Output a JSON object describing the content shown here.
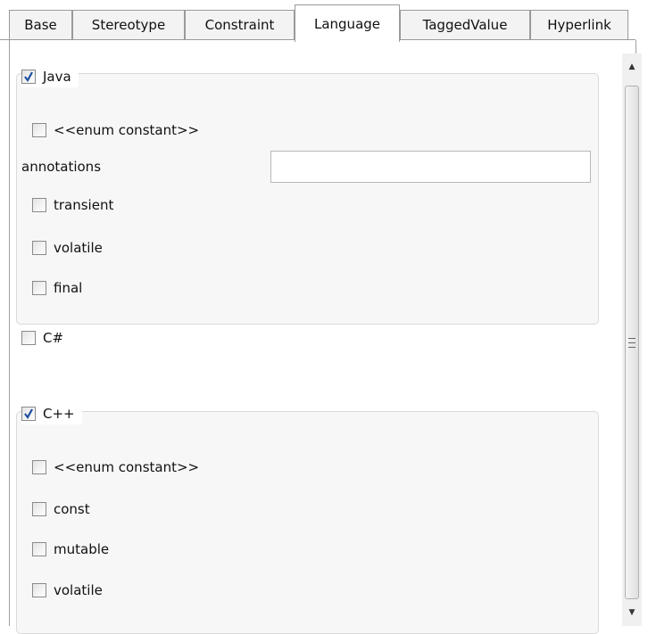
{
  "tabs": [
    {
      "label": "Base",
      "active": false
    },
    {
      "label": "Stereotype",
      "active": false
    },
    {
      "label": "Constraint",
      "active": false
    },
    {
      "label": "Language",
      "active": true
    },
    {
      "label": "TaggedValue",
      "active": false
    },
    {
      "label": "Hyperlink",
      "active": false
    }
  ],
  "java": {
    "label": "Java",
    "checked": true,
    "enum_constant": {
      "label": "<<enum constant>>",
      "checked": false
    },
    "annotations": {
      "label": "annotations",
      "value": ""
    },
    "transient": {
      "label": "transient",
      "checked": false
    },
    "volatile": {
      "label": "volatile",
      "checked": false
    },
    "final": {
      "label": "final",
      "checked": false
    }
  },
  "csharp": {
    "label": "C#",
    "checked": false
  },
  "cpp": {
    "label": "C++",
    "checked": true,
    "enum_constant": {
      "label": "<<enum constant>>",
      "checked": false
    },
    "const": {
      "label": "const",
      "checked": false
    },
    "mutable": {
      "label": "mutable",
      "checked": false
    },
    "volatile": {
      "label": "volatile",
      "checked": false
    }
  },
  "colors": {
    "check": "#1f4f9e",
    "panel_bg": "#f7f7f7",
    "border": "#9a9a9a"
  }
}
